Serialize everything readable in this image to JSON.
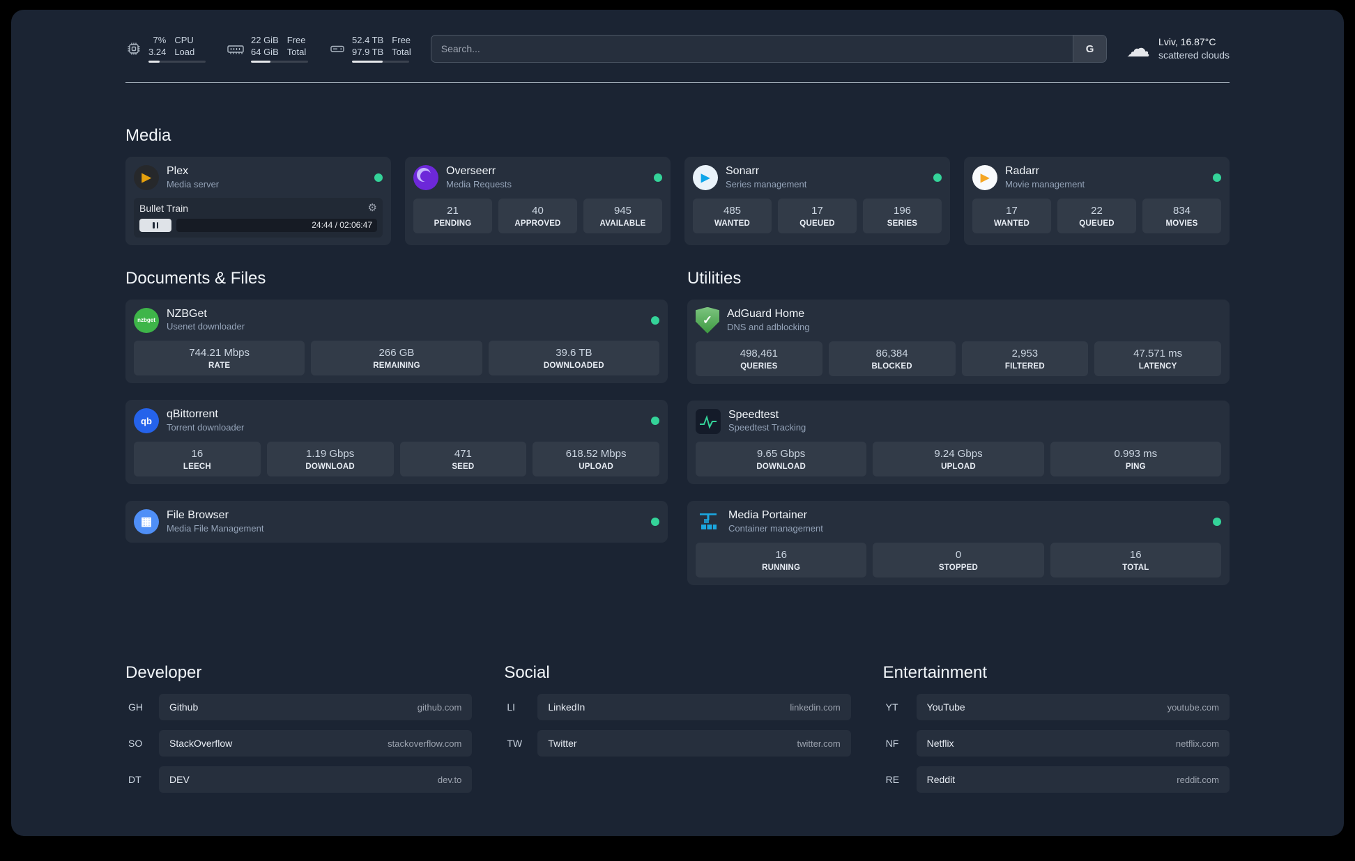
{
  "topbar": {
    "resources": [
      {
        "icon": "cpu-icon",
        "v1": "7%",
        "v2": "3.24",
        "l1": "CPU",
        "l2": "Load",
        "bar": "width:20%"
      },
      {
        "icon": "ram-icon",
        "v1": "22 GiB",
        "v2": "64 GiB",
        "l1": "Free",
        "l2": "Total",
        "bar": "width:34%"
      },
      {
        "icon": "disk-icon",
        "v1": "52.4 TB",
        "v2": "97.9 TB",
        "l1": "Free",
        "l2": "Total",
        "bar": "width:54%"
      }
    ],
    "search": {
      "placeholder": "Search...",
      "button_label": "G"
    },
    "weather": {
      "location": "Lviv, 16.87°C",
      "condition": "scattered clouds"
    }
  },
  "media": {
    "heading": "Media",
    "plex": {
      "title": "Plex",
      "subtitle": "Media server",
      "now_playing": "Bullet Train",
      "time": "24:44 / 02:06:47"
    },
    "overseerr": {
      "title": "Overseerr",
      "subtitle": "Media Requests",
      "stats": [
        {
          "value": "21",
          "label": "PENDING"
        },
        {
          "value": "40",
          "label": "APPROVED"
        },
        {
          "value": "945",
          "label": "AVAILABLE"
        }
      ]
    },
    "sonarr": {
      "title": "Sonarr",
      "subtitle": "Series management",
      "stats": [
        {
          "value": "485",
          "label": "WANTED"
        },
        {
          "value": "17",
          "label": "QUEUED"
        },
        {
          "value": "196",
          "label": "SERIES"
        }
      ]
    },
    "radarr": {
      "title": "Radarr",
      "subtitle": "Movie management",
      "stats": [
        {
          "value": "17",
          "label": "WANTED"
        },
        {
          "value": "22",
          "label": "QUEUED"
        },
        {
          "value": "834",
          "label": "MOVIES"
        }
      ]
    }
  },
  "documents": {
    "heading": "Documents & Files",
    "nzbget": {
      "title": "NZBGet",
      "subtitle": "Usenet downloader",
      "icon_text": "nzbget",
      "stats": [
        {
          "value": "744.21 Mbps",
          "label": "RATE"
        },
        {
          "value": "266 GB",
          "label": "REMAINING"
        },
        {
          "value": "39.6 TB",
          "label": "DOWNLOADED"
        }
      ]
    },
    "qbittorrent": {
      "title": "qBittorrent",
      "subtitle": "Torrent downloader",
      "icon_text": "qb",
      "stats": [
        {
          "value": "16",
          "label": "LEECH"
        },
        {
          "value": "1.19 Gbps",
          "label": "DOWNLOAD"
        },
        {
          "value": "471",
          "label": "SEED"
        },
        {
          "value": "618.52 Mbps",
          "label": "UPLOAD"
        }
      ]
    },
    "filebrowser": {
      "title": "File Browser",
      "subtitle": "Media File Management"
    }
  },
  "utilities": {
    "heading": "Utilities",
    "adguard": {
      "title": "AdGuard Home",
      "subtitle": "DNS and adblocking",
      "stats": [
        {
          "value": "498,461",
          "label": "QUERIES"
        },
        {
          "value": "86,384",
          "label": "BLOCKED"
        },
        {
          "value": "2,953",
          "label": "FILTERED"
        },
        {
          "value": "47.571 ms",
          "label": "LATENCY"
        }
      ]
    },
    "speedtest": {
      "title": "Speedtest",
      "subtitle": "Speedtest Tracking",
      "stats": [
        {
          "value": "9.65 Gbps",
          "label": "DOWNLOAD"
        },
        {
          "value": "9.24 Gbps",
          "label": "UPLOAD"
        },
        {
          "value": "0.993 ms",
          "label": "PING"
        }
      ]
    },
    "portainer": {
      "title": "Media Portainer",
      "subtitle": "Container management",
      "stats": [
        {
          "value": "16",
          "label": "RUNNING"
        },
        {
          "value": "0",
          "label": "STOPPED"
        },
        {
          "value": "16",
          "label": "TOTAL"
        }
      ]
    }
  },
  "bookmarks": [
    {
      "heading": "Developer",
      "items": [
        {
          "abbr": "GH",
          "name": "Github",
          "domain": "github.com"
        },
        {
          "abbr": "SO",
          "name": "StackOverflow",
          "domain": "stackoverflow.com"
        },
        {
          "abbr": "DT",
          "name": "DEV",
          "domain": "dev.to"
        }
      ]
    },
    {
      "heading": "Social",
      "items": [
        {
          "abbr": "LI",
          "name": "LinkedIn",
          "domain": "linkedin.com"
        },
        {
          "abbr": "TW",
          "name": "Twitter",
          "domain": "twitter.com"
        }
      ]
    },
    {
      "heading": "Entertainment",
      "items": [
        {
          "abbr": "YT",
          "name": "YouTube",
          "domain": "youtube.com"
        },
        {
          "abbr": "NF",
          "name": "Netflix",
          "domain": "netflix.com"
        },
        {
          "abbr": "RE",
          "name": "Reddit",
          "domain": "reddit.com"
        }
      ]
    }
  ],
  "colors": {
    "background": "#1b2433",
    "card": "#27303f",
    "status_online": "#34d399",
    "plex_accent": "#e5a00d",
    "overseerr_accent": "#6d28d9",
    "adguard_accent": "#3d9940",
    "portainer_accent": "#1ba7e0"
  }
}
